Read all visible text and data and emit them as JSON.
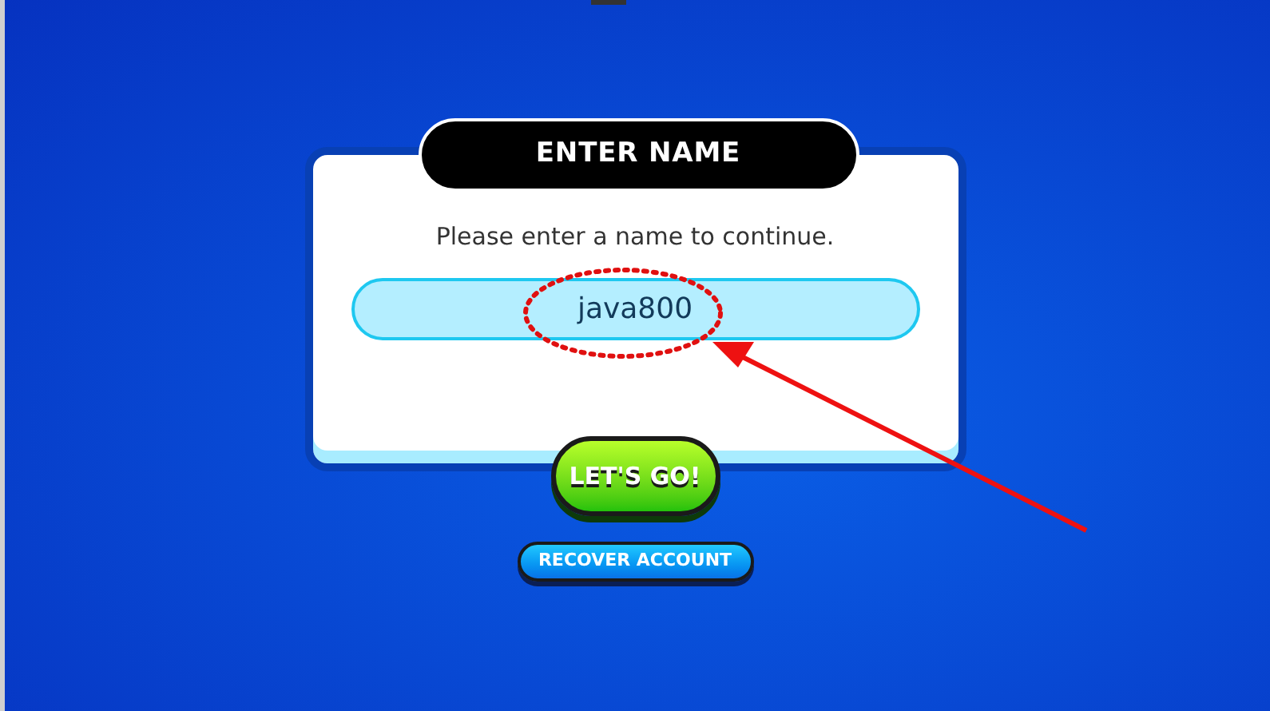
{
  "dialog": {
    "title": "ENTER NAME",
    "prompt": "Please enter a name to continue.",
    "name_field": {
      "value": "java800"
    }
  },
  "buttons": [
    {
      "kind": "primary",
      "label": "LET'S GO!"
    },
    {
      "kind": "secondary",
      "label": "RECOVER ACCOUNT"
    }
  ]
}
